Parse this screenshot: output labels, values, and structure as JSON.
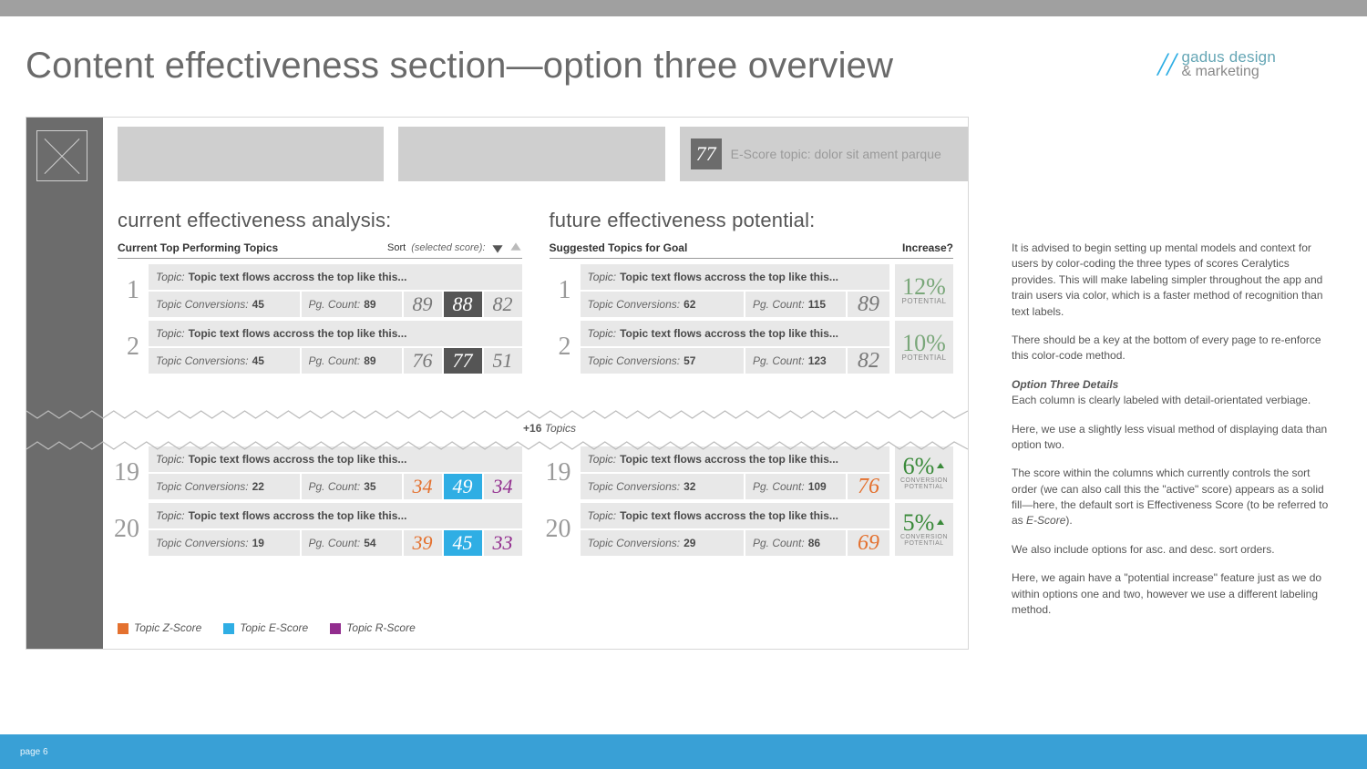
{
  "page": {
    "title": "Content effectiveness section—option three overview",
    "footer": "page 6"
  },
  "brand": {
    "line1": "gadus design",
    "line2": "& marketing"
  },
  "mock": {
    "escore_chip": "77",
    "escore_label": "E-Score topic: dolor sit ament parque",
    "torn_label_prefix": "+16",
    "torn_label_suffix": "Topics",
    "left": {
      "heading": "current effectiveness analysis:",
      "header_label": "Current Top Performing Topics",
      "sort_label": "Sort",
      "sort_hint": "(selected score):",
      "rows": [
        {
          "rank": "1",
          "topic_prefix": "Topic:",
          "topic_text": "Topic text flows accross the top like this...",
          "conv_label": "Topic Conversions:",
          "conv": "45",
          "pg_label": "Pg. Count:",
          "pg": "89",
          "z": "89",
          "e": "88",
          "r": "82"
        },
        {
          "rank": "2",
          "topic_prefix": "Topic:",
          "topic_text": "Topic text flows accross the top like this...",
          "conv_label": "Topic Conversions:",
          "conv": "45",
          "pg_label": "Pg. Count:",
          "pg": "89",
          "z": "76",
          "e": "77",
          "r": "51"
        },
        {
          "rank": "19",
          "topic_prefix": "Topic:",
          "topic_text": "Topic text flows accross the top like this...",
          "conv_label": "Topic Conversions:",
          "conv": "22",
          "pg_label": "Pg. Count:",
          "pg": "35",
          "z": "34",
          "e": "49",
          "r": "34"
        },
        {
          "rank": "20",
          "topic_prefix": "Topic:",
          "topic_text": "Topic text flows accross the top like this...",
          "conv_label": "Topic Conversions:",
          "conv": "19",
          "pg_label": "Pg. Count:",
          "pg": "54",
          "z": "39",
          "e": "45",
          "r": "33"
        }
      ]
    },
    "right": {
      "heading": "future effectiveness potential:",
      "header_label": "Suggested Topics for Goal",
      "increase_label": "Increase?",
      "rows": [
        {
          "rank": "1",
          "topic_prefix": "Topic:",
          "topic_text": "Topic text flows accross the top like this...",
          "conv_label": "Topic Conversions:",
          "conv": "62",
          "pg_label": "Pg. Count:",
          "pg": "115",
          "e": "89",
          "pot_pct": "12%",
          "pot_label": "POTENTIAL"
        },
        {
          "rank": "2",
          "topic_prefix": "Topic:",
          "topic_text": "Topic text flows accross the top like this...",
          "conv_label": "Topic Conversions:",
          "conv": "57",
          "pg_label": "Pg. Count:",
          "pg": "123",
          "e": "82",
          "pot_pct": "10%",
          "pot_label": "POTENTIAL"
        },
        {
          "rank": "19",
          "topic_prefix": "Topic:",
          "topic_text": "Topic text flows accross the top like this...",
          "conv_label": "Topic Conversions:",
          "conv": "32",
          "pg_label": "Pg. Count:",
          "pg": "109",
          "e": "76",
          "pot_pct": "6%",
          "pot_label": "CONVERSION POTENTIAL"
        },
        {
          "rank": "20",
          "topic_prefix": "Topic:",
          "topic_text": "Topic text flows accross the top like this...",
          "conv_label": "Topic Conversions:",
          "conv": "29",
          "pg_label": "Pg. Count:",
          "pg": "86",
          "e": "69",
          "pot_pct": "5%",
          "pot_label": "CONVERSION POTENTIAL"
        }
      ]
    },
    "legend": {
      "z": "Topic Z-Score",
      "e": "Topic E-Score",
      "r": "Topic R-Score"
    }
  },
  "notes": {
    "p1": "It is advised to begin setting up mental models and context for users by color-coding the three types of scores Ceralytics provides. This will make labeling simpler throughout the app and train users via color, which is a faster method of recognition than text labels.",
    "p2": "There should be a key at the bottom of every page to re-enforce this color-code method.",
    "h3": "Option Three Details",
    "p3": "Each column is clearly labeled with detail-orientated verbiage.",
    "p4": "Here, we use a slightly less visual method of displaying data than option two.",
    "p5a": "The score within the columns which currently controls the sort order (we can also call this the \"active\" score) appears as a solid fill—here, the default sort is Effectiveness Score (to be referred to as ",
    "p5b": "E-Score",
    "p5c": ").",
    "p6": "We also include options for asc. and desc. sort orders.",
    "p7": "Here, we again have a \"potential increase\" feature just as we do within options one and two, however we use a different labeling method."
  }
}
